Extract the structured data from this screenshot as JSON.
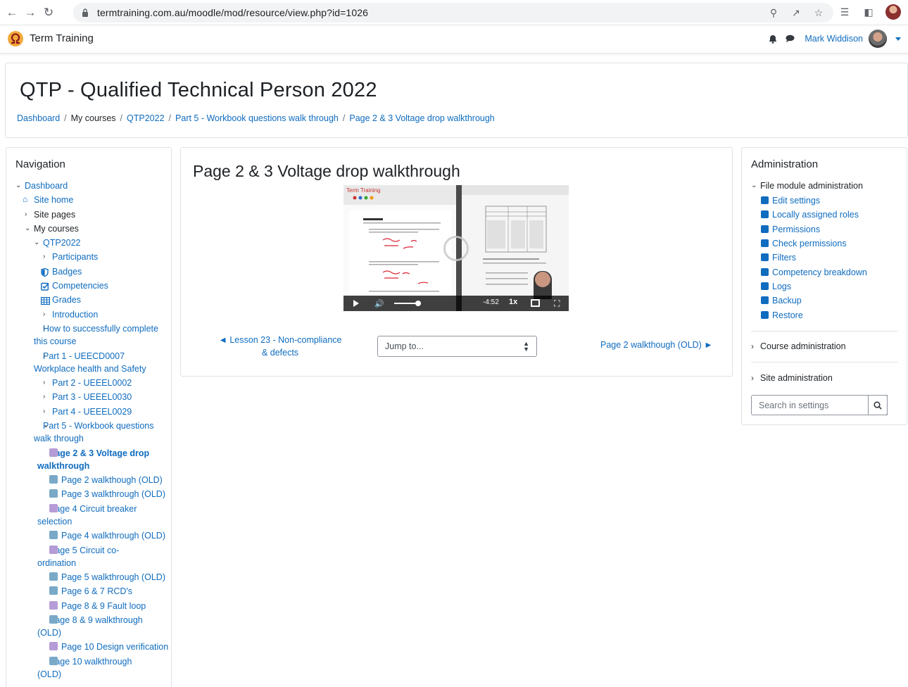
{
  "browser": {
    "url": "termtraining.com.au/moodle/mod/resource/view.php?id=1026"
  },
  "navbar": {
    "brand": "Term Training",
    "user_name": "Mark Widdison"
  },
  "header": {
    "title": "QTP - Qualified Technical Person 2022",
    "breadcrumbs": [
      "Dashboard",
      "My courses",
      "QTP2022",
      "Part 5 - Workbook questions walk through",
      "Page 2 & 3 Voltage drop walkthrough"
    ]
  },
  "navigation": {
    "title": "Navigation",
    "items": [
      "Dashboard",
      "Site home",
      "Site pages",
      "My courses",
      "QTP2022",
      "Participants",
      "Badges",
      "Competencies",
      "Grades",
      "Introduction",
      "How to successfully complete this course",
      "Part 1 - UEECD0007 Workplace health and Safety",
      "Part 2 - UEEEL0002",
      "Part 3 - UEEEL0030",
      "Part 4 - UEEEL0029",
      "Part 5 - Workbook questions walk through",
      "Page 2 & 3 Voltage drop walkthrough",
      "Page 2 walkthough (OLD)",
      "Page 3 walkthrough (OLD)",
      "Page 4 Circuit breaker selection",
      "Page 4 walkthrough (OLD)",
      "Page 5 Circuit co-ordination",
      "Page 5 walkthrough (OLD)",
      "Page 6 & 7 RCD's",
      "Page 8 & 9 Fault loop",
      "Page 8 & 9 walkthrough (OLD)",
      "Page 10 Design verification",
      "Page 10 walkthrough (OLD)"
    ]
  },
  "main": {
    "title": "Page 2 & 3 Voltage drop walkthrough",
    "video": {
      "time": "-4:52",
      "speed": "1x"
    },
    "prev_link": "◄ Lesson 23 - Non-compliance & defects",
    "jump_placeholder": "Jump to...",
    "next_link": "Page 2 walkthough (OLD) ►"
  },
  "administration": {
    "title": "Administration",
    "file_module": "File module administration",
    "items": [
      "Edit settings",
      "Locally assigned roles",
      "Permissions",
      "Check permissions",
      "Filters",
      "Competency breakdown",
      "Logs",
      "Backup",
      "Restore"
    ],
    "course_admin": "Course administration",
    "site_admin": "Site administration",
    "search_placeholder": "Search in settings"
  },
  "colors": {
    "link": "#0f6cbf",
    "text": "#1d2125",
    "border": "#dee2e6"
  }
}
